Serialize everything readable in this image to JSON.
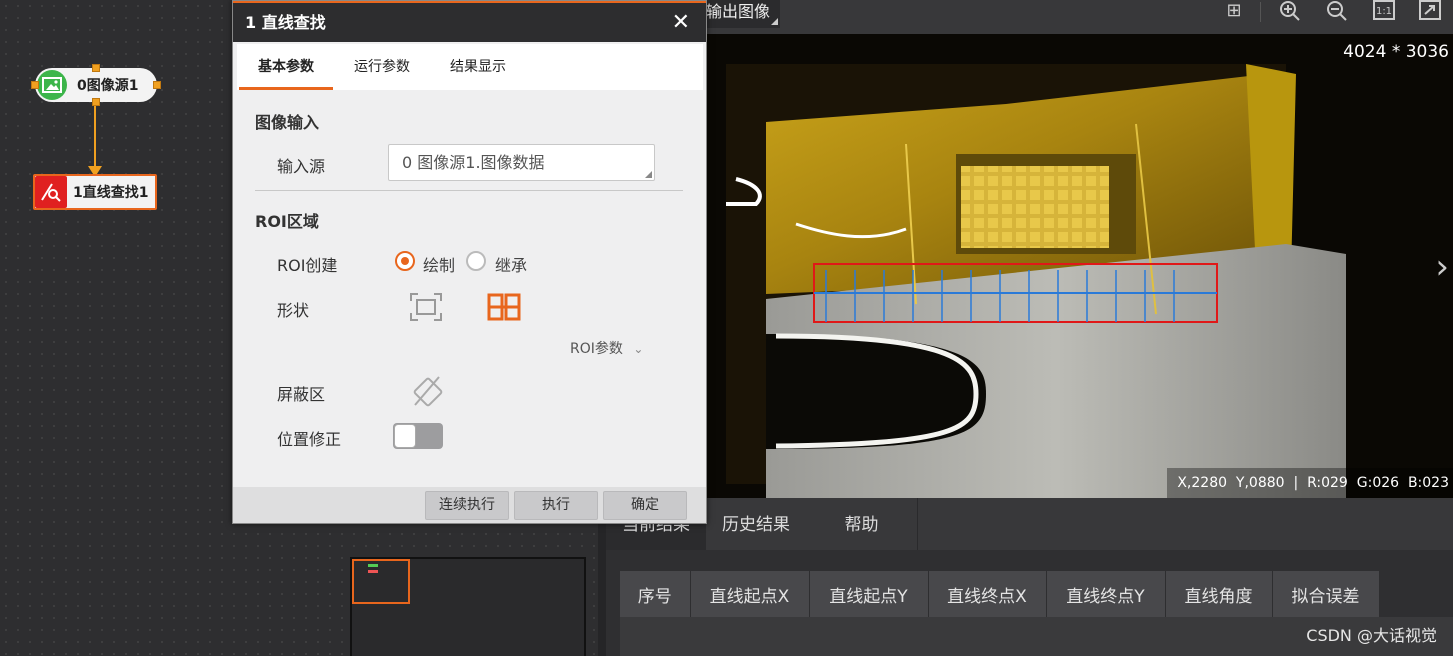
{
  "flow": {
    "node_source": {
      "label": "0图像源1",
      "icon": "image-icon"
    },
    "node_line": {
      "label": "1直线查找1",
      "icon": "line-find-icon"
    }
  },
  "topbar": {
    "output_label": "输出图像",
    "tools": [
      "grid-icon",
      "zoom-in-icon",
      "zoom-out-icon",
      "actual-size-icon",
      "fit-window-icon"
    ]
  },
  "image": {
    "size_text": "4024 * 3036",
    "pixel_x": "X,2280",
    "pixel_y": "Y,0880",
    "separator": "|",
    "r": "R:029",
    "g": "G:026",
    "b": "B:023"
  },
  "results": {
    "tabs": [
      "当前结果",
      "历史结果",
      "帮助"
    ],
    "active_tab": 0,
    "columns": [
      "序号",
      "直线起点X",
      "直线起点Y",
      "直线终点X",
      "直线终点Y",
      "直线角度",
      "拟合误差"
    ]
  },
  "watermark": "CSDN @大话视觉",
  "dialog": {
    "title": "1 直线查找",
    "tabs": [
      "基本参数",
      "运行参数",
      "结果显示"
    ],
    "active_tab": 0,
    "section_input": "图像输入",
    "input_source_label": "输入源",
    "input_source_value": "0 图像源1.图像数据",
    "section_roi": "ROI区域",
    "roi_create_label": "ROI创建",
    "roi_create_options": [
      "绘制",
      "继承"
    ],
    "roi_create_selected": 0,
    "shape_label": "形状",
    "roi_params_label": "ROI参数",
    "mask_label": "屏蔽区",
    "position_fix_label": "位置修正",
    "position_fix_on": false,
    "buttons": {
      "continuous": "连续执行",
      "run": "执行",
      "confirm": "确定"
    },
    "colors": {
      "accent": "#e8661d"
    }
  }
}
